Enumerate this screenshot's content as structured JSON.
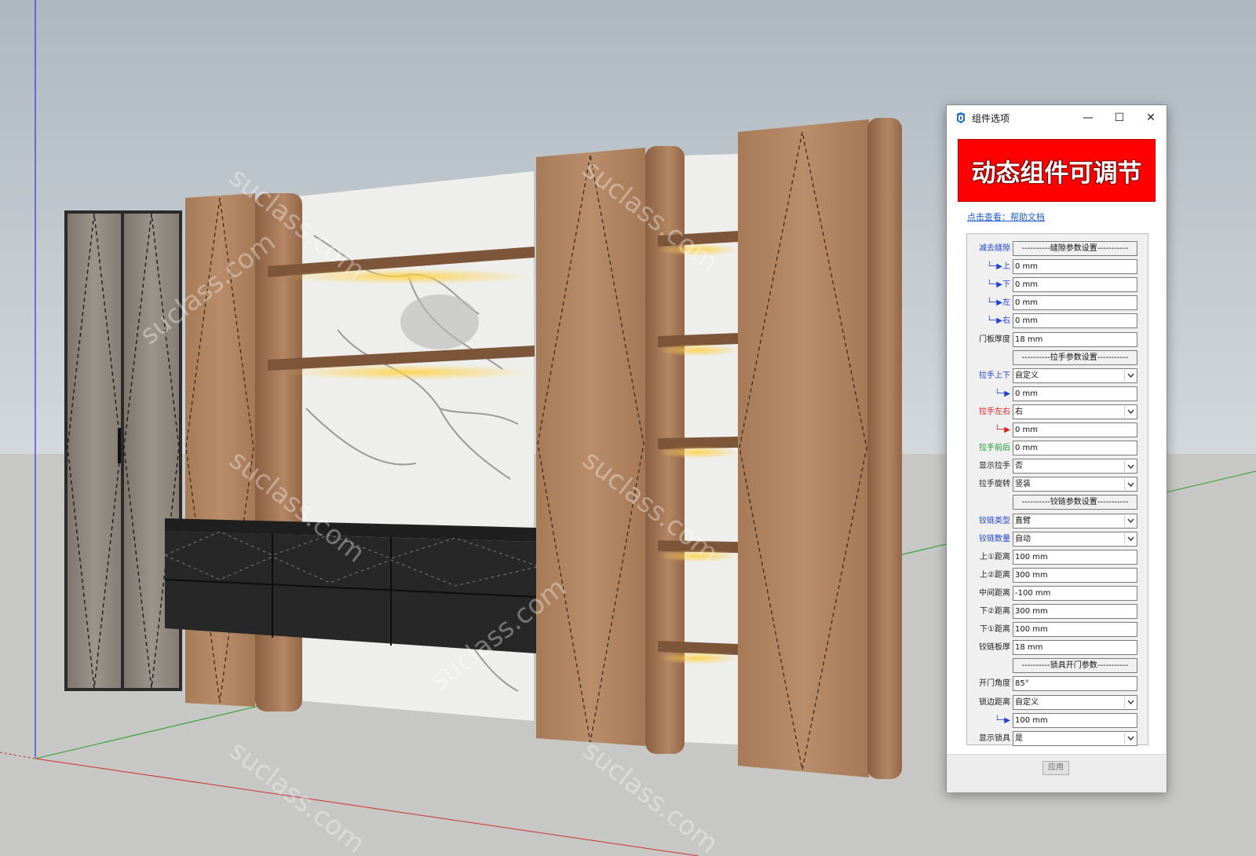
{
  "watermark": "suclass.com",
  "dialog": {
    "title": "组件选项",
    "controls": {
      "minimize": "—",
      "maximize": "☐",
      "close": "✕"
    },
    "banner": "动态组件可调节",
    "help_link": "点击查看：帮助文档",
    "apply_button": "应用",
    "rows": [
      {
        "label": "减去缝隙",
        "label_color": "#1f3fd6",
        "kind": "section",
        "value": "----------缝隙参数设置-----------"
      },
      {
        "label": "└─▶上",
        "label_color": "#1f3fd6",
        "kind": "input",
        "value": "0 mm"
      },
      {
        "label": "└─▶下",
        "label_color": "#1f3fd6",
        "kind": "input",
        "value": "0 mm"
      },
      {
        "label": "└─▶左",
        "label_color": "#1f3fd6",
        "kind": "input",
        "value": "0 mm"
      },
      {
        "label": "└─▶右",
        "label_color": "#1f3fd6",
        "kind": "input",
        "value": "0 mm"
      },
      {
        "label": "门板厚度",
        "label_color": "#222222",
        "kind": "input",
        "value": "18 mm"
      },
      {
        "label": "",
        "label_color": "#222222",
        "kind": "section",
        "value": "----------拉手参数设置-----------"
      },
      {
        "label": "拉手上下",
        "label_color": "#1f3fd6",
        "kind": "select",
        "value": "自定义"
      },
      {
        "label": "└─▶",
        "label_color": "#1f3fd6",
        "kind": "input",
        "value": "0 mm"
      },
      {
        "label": "拉手左右",
        "label_color": "#e01b1b",
        "kind": "select",
        "value": "右"
      },
      {
        "label": "└─▶",
        "label_color": "#e01b1b",
        "kind": "input",
        "value": "0 mm"
      },
      {
        "label": "拉手前后",
        "label_color": "#1a9a2a",
        "kind": "input",
        "value": "0 mm"
      },
      {
        "label": "显示拉手",
        "label_color": "#222222",
        "kind": "select",
        "value": "否"
      },
      {
        "label": "拉手旋转",
        "label_color": "#222222",
        "kind": "select",
        "value": "竖装"
      },
      {
        "label": "",
        "label_color": "#222222",
        "kind": "section",
        "value": "----------铰链参数设置-----------"
      },
      {
        "label": "铰链类型",
        "label_color": "#1f3fd6",
        "kind": "select",
        "value": "直臂"
      },
      {
        "label": "铰链数量",
        "label_color": "#1f3fd6",
        "kind": "select",
        "value": "自动"
      },
      {
        "label": "上①距离",
        "label_color": "#222222",
        "kind": "input",
        "value": "100 mm"
      },
      {
        "label": "上②距离",
        "label_color": "#222222",
        "kind": "input",
        "value": "300 mm"
      },
      {
        "label": "中间距离",
        "label_color": "#222222",
        "kind": "input",
        "value": "-100 mm"
      },
      {
        "label": "下②距离",
        "label_color": "#222222",
        "kind": "input",
        "value": "300 mm"
      },
      {
        "label": "下①距离",
        "label_color": "#222222",
        "kind": "input",
        "value": "100 mm"
      },
      {
        "label": "铰链板厚",
        "label_color": "#222222",
        "kind": "input",
        "value": "18 mm"
      },
      {
        "label": "",
        "label_color": "#222222",
        "kind": "section",
        "value": "----------锁具开门参数-----------"
      },
      {
        "label": "开门角度",
        "label_color": "#222222",
        "kind": "input",
        "value": "85°"
      },
      {
        "label": "锁边距离",
        "label_color": "#222222",
        "kind": "select",
        "value": "自定义"
      },
      {
        "label": "└─▶",
        "label_color": "#1f3fd6",
        "kind": "input",
        "value": "100 mm"
      },
      {
        "label": "显示锁具",
        "label_color": "#222222",
        "kind": "select",
        "value": "是"
      }
    ]
  }
}
